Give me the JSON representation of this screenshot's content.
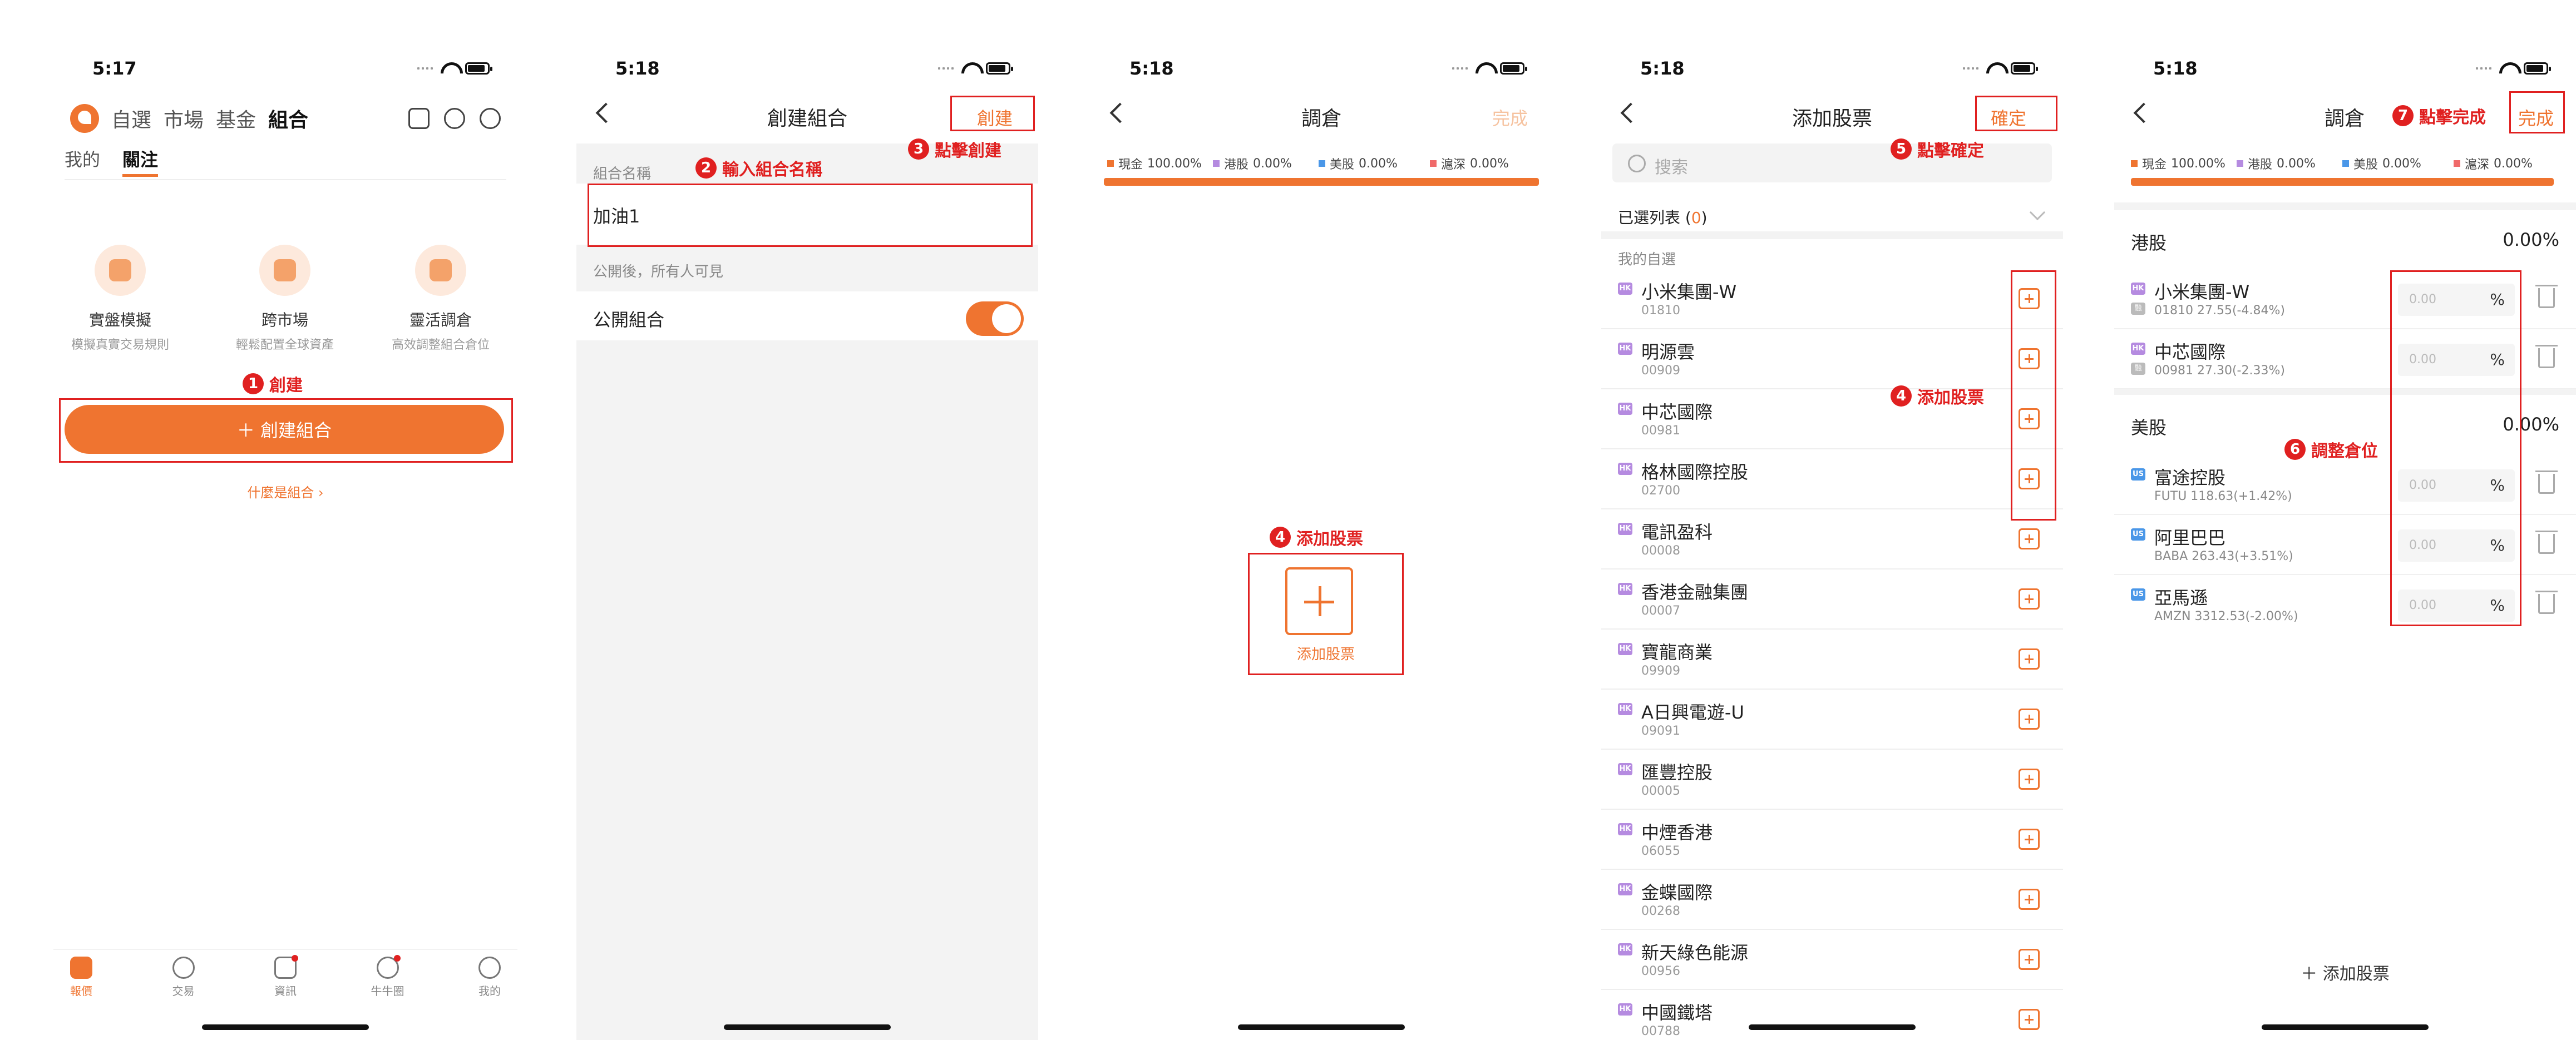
{
  "colors": {
    "accent": "#ef7430",
    "annotation": "#e02020",
    "hk_tag": "#b58be0",
    "us_tag": "#4a97e8"
  },
  "s1": {
    "time": "5:17",
    "top_tabs": [
      "自選",
      "市場",
      "基金",
      "組合"
    ],
    "sub_tabs": [
      "我的",
      "關注"
    ],
    "features": [
      {
        "title": "實盤模擬",
        "desc": "模擬真實交易規則",
        "icon": "simulation-icon"
      },
      {
        "title": "跨市場",
        "desc": "輕鬆配置全球資產",
        "icon": "globe-icon"
      },
      {
        "title": "靈活調倉",
        "desc": "高效調整組合倉位",
        "icon": "rebalance-icon"
      }
    ],
    "ann_num": "1",
    "ann_text": "創建",
    "create_btn": "＋ 創建組合",
    "what_link": "什麼是組合 ›",
    "tabbar": [
      "報價",
      "交易",
      "資訊",
      "牛牛圈",
      "我的"
    ]
  },
  "s2": {
    "time": "5:18",
    "title": "創建組合",
    "right": "創建",
    "ann2_num": "2",
    "ann2_text": "輸入組合名稱",
    "ann3_num": "3",
    "ann3_text": "點擊創建",
    "name_label": "組合名稱",
    "name_value": "加油1",
    "public_hint": "公開後，所有人可見",
    "public_label": "公開組合"
  },
  "s3": {
    "time": "5:18",
    "title": "調倉",
    "right": "完成",
    "alloc": [
      {
        "label": "現金",
        "value": "100.00%",
        "color": "#ef7430"
      },
      {
        "label": "港股",
        "value": "0.00%",
        "color": "#b58be0"
      },
      {
        "label": "美股",
        "value": "0.00%",
        "color": "#4a97e8"
      },
      {
        "label": "滬深",
        "value": "0.00%",
        "color": "#f06a6a"
      }
    ],
    "ann_num": "4",
    "ann_text": "添加股票",
    "add_label": "添加股票"
  },
  "s4": {
    "time": "5:18",
    "title": "添加股票",
    "right": "確定",
    "search_placeholder": "搜索",
    "selected_label": "已選列表 (",
    "selected_count": "0",
    "selected_close": ")",
    "section": "我的自選",
    "ann4_num": "4",
    "ann4_text": "添加股票",
    "ann5_num": "5",
    "ann5_text": "點擊確定",
    "stocks": [
      {
        "name": "小米集團-W",
        "code": "01810",
        "tag": "HK"
      },
      {
        "name": "明源雲",
        "code": "00909",
        "tag": "HK"
      },
      {
        "name": "中芯國際",
        "code": "00981",
        "tag": "HK"
      },
      {
        "name": "格林國際控股",
        "code": "02700",
        "tag": "HK"
      },
      {
        "name": "電訊盈科",
        "code": "00008",
        "tag": "HK"
      },
      {
        "name": "香港金融集團",
        "code": "00007",
        "tag": "HK"
      },
      {
        "name": "寶龍商業",
        "code": "09909",
        "tag": "HK"
      },
      {
        "name": "A日興電遊-U",
        "code": "09091",
        "tag": "HK"
      },
      {
        "name": "匯豐控股",
        "code": "00005",
        "tag": "HK"
      },
      {
        "name": "中煙香港",
        "code": "06055",
        "tag": "HK"
      },
      {
        "name": "金蝶國際",
        "code": "00268",
        "tag": "HK"
      },
      {
        "name": "新天綠色能源",
        "code": "00956",
        "tag": "HK"
      },
      {
        "name": "中國鐵塔",
        "code": "00788",
        "tag": "HK"
      }
    ]
  },
  "s5": {
    "time": "5:18",
    "title": "調倉",
    "right": "完成",
    "ann6_num": "6",
    "ann6_text": "調整倉位",
    "ann7_num": "7",
    "ann7_text": "點擊完成",
    "hk_section": "港股",
    "hk_pct": "0.00%",
    "us_section": "美股",
    "us_pct": "0.00%",
    "hk_rows": [
      {
        "name": "小米集團-W",
        "info": "01810  27.55(-4.84%)",
        "value": "0.00",
        "tag": "HK",
        "tag2": "融"
      },
      {
        "name": "中芯國際",
        "info": "00981  27.30(-2.33%)",
        "value": "0.00",
        "tag": "HK",
        "tag2": "融"
      }
    ],
    "us_rows": [
      {
        "name": "富途控股",
        "info": "FUTU  118.63(+1.42%)",
        "value": "0.00",
        "tag": "US"
      },
      {
        "name": "阿里巴巴",
        "info": "BABA  263.43(+3.51%)",
        "value": "0.00",
        "tag": "US"
      },
      {
        "name": "亞馬遜",
        "info": "AMZN  3312.53(-2.00%)",
        "value": "0.00",
        "tag": "US"
      }
    ],
    "pct_sign": "%",
    "add_btn": "＋ 添加股票"
  }
}
